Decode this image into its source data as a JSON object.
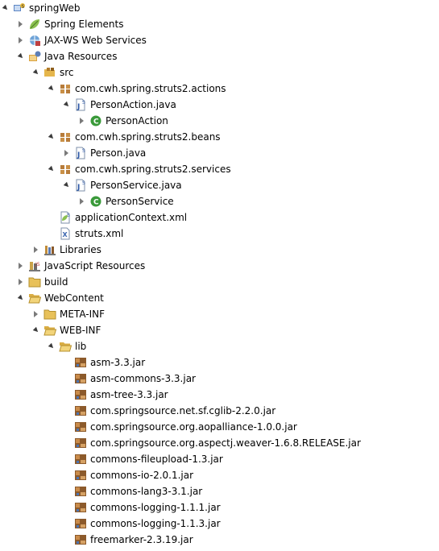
{
  "colors": {
    "twisty": "#6d6d6d",
    "jar": "#8c5a2b",
    "folder": "#e8c15a",
    "class_green": "#3a9a3a"
  },
  "tree": [
    {
      "label": "springWeb",
      "icon": "project-icon",
      "level": 0,
      "state": "expanded"
    },
    {
      "label": "Spring Elements",
      "icon": "spring-leaf-icon",
      "level": 1,
      "state": "collapsed"
    },
    {
      "label": "JAX-WS Web Services",
      "icon": "webservice-icon",
      "level": 1,
      "state": "collapsed"
    },
    {
      "label": "Java Resources",
      "icon": "java-resources-icon",
      "level": 1,
      "state": "expanded"
    },
    {
      "label": "src",
      "icon": "source-folder-icon",
      "level": 2,
      "state": "expanded"
    },
    {
      "label": "com.cwh.spring.struts2.actions",
      "icon": "package-icon",
      "level": 3,
      "state": "expanded"
    },
    {
      "label": "PersonAction.java",
      "icon": "java-file-icon",
      "level": 4,
      "state": "expanded"
    },
    {
      "label": "PersonAction",
      "icon": "class-icon",
      "level": 5,
      "state": "collapsed"
    },
    {
      "label": "com.cwh.spring.struts2.beans",
      "icon": "package-icon",
      "level": 3,
      "state": "expanded"
    },
    {
      "label": "Person.java",
      "icon": "java-file-icon",
      "level": 4,
      "state": "collapsed"
    },
    {
      "label": "com.cwh.spring.struts2.services",
      "icon": "package-icon",
      "level": 3,
      "state": "expanded"
    },
    {
      "label": "PersonService.java",
      "icon": "java-file-icon",
      "level": 4,
      "state": "expanded"
    },
    {
      "label": "PersonService",
      "icon": "class-icon",
      "level": 5,
      "state": "collapsed"
    },
    {
      "label": "applicationContext.xml",
      "icon": "spring-xml-icon",
      "level": 3,
      "state": "none"
    },
    {
      "label": "struts.xml",
      "icon": "xml-file-icon",
      "level": 3,
      "state": "none"
    },
    {
      "label": "Libraries",
      "icon": "libraries-icon",
      "level": 2,
      "state": "collapsed"
    },
    {
      "label": "JavaScript Resources",
      "icon": "js-resources-icon",
      "level": 1,
      "state": "collapsed"
    },
    {
      "label": "build",
      "icon": "folder-icon",
      "level": 1,
      "state": "collapsed"
    },
    {
      "label": "WebContent",
      "icon": "open-folder-icon",
      "level": 1,
      "state": "expanded"
    },
    {
      "label": "META-INF",
      "icon": "folder-icon",
      "level": 2,
      "state": "collapsed"
    },
    {
      "label": "WEB-INF",
      "icon": "open-folder-icon",
      "level": 2,
      "state": "expanded"
    },
    {
      "label": "lib",
      "icon": "open-folder-icon",
      "level": 3,
      "state": "expanded"
    },
    {
      "label": "asm-3.3.jar",
      "icon": "jar-icon",
      "level": 4,
      "state": "none"
    },
    {
      "label": "asm-commons-3.3.jar",
      "icon": "jar-icon",
      "level": 4,
      "state": "none"
    },
    {
      "label": "asm-tree-3.3.jar",
      "icon": "jar-icon",
      "level": 4,
      "state": "none"
    },
    {
      "label": "com.springsource.net.sf.cglib-2.2.0.jar",
      "icon": "jar-icon",
      "level": 4,
      "state": "none"
    },
    {
      "label": "com.springsource.org.aopalliance-1.0.0.jar",
      "icon": "jar-icon",
      "level": 4,
      "state": "none"
    },
    {
      "label": "com.springsource.org.aspectj.weaver-1.6.8.RELEASE.jar",
      "icon": "jar-icon",
      "level": 4,
      "state": "none"
    },
    {
      "label": "commons-fileupload-1.3.jar",
      "icon": "jar-icon",
      "level": 4,
      "state": "none"
    },
    {
      "label": "commons-io-2.0.1.jar",
      "icon": "jar-icon",
      "level": 4,
      "state": "none"
    },
    {
      "label": "commons-lang3-3.1.jar",
      "icon": "jar-icon",
      "level": 4,
      "state": "none"
    },
    {
      "label": "commons-logging-1.1.1.jar",
      "icon": "jar-icon",
      "level": 4,
      "state": "none"
    },
    {
      "label": "commons-logging-1.1.3.jar",
      "icon": "jar-icon",
      "level": 4,
      "state": "none"
    },
    {
      "label": "freemarker-2.3.19.jar",
      "icon": "jar-icon",
      "level": 4,
      "state": "none"
    }
  ]
}
